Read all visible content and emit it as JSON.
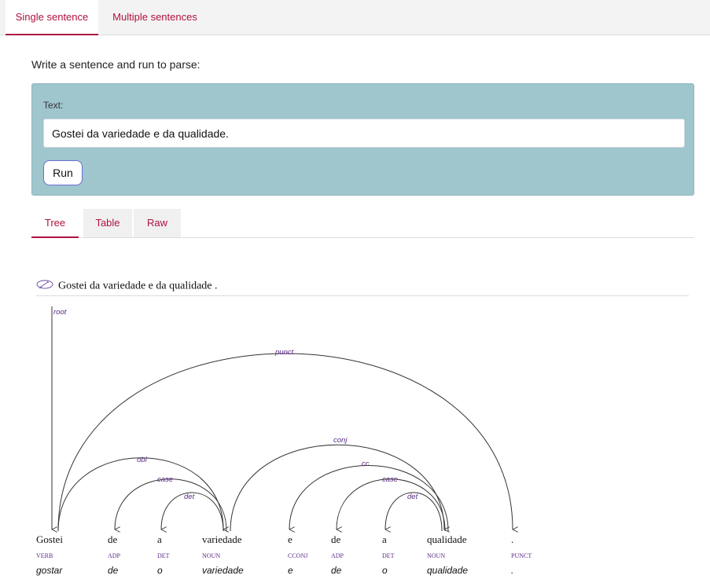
{
  "tabs": {
    "single": "Single sentence",
    "multiple": "Multiple sentences"
  },
  "prompt": "Write a sentence and run to parse:",
  "form": {
    "label": "Text:",
    "value": "Gostei da variedade e da qualidade.",
    "run": "Run"
  },
  "view_tabs": {
    "tree": "Tree",
    "table": "Table",
    "raw": "Raw"
  },
  "parse": {
    "sentence": "Gostei da variedade e da qualidade .",
    "tokens": [
      {
        "word": "Gostei",
        "pos": "VERB",
        "lemma": "gostar"
      },
      {
        "word": "de",
        "pos": "ADP",
        "lemma": "de"
      },
      {
        "word": "a",
        "pos": "DET",
        "lemma": "o"
      },
      {
        "word": "variedade",
        "pos": "NOUN",
        "lemma": "variedade"
      },
      {
        "word": "e",
        "pos": "CCONJ",
        "lemma": "e"
      },
      {
        "word": "de",
        "pos": "ADP",
        "lemma": "de"
      },
      {
        "word": "a",
        "pos": "DET",
        "lemma": "o"
      },
      {
        "word": "qualidade",
        "pos": "NOUN",
        "lemma": "qualidade"
      },
      {
        "word": ".",
        "pos": "PUNCT",
        "lemma": "."
      }
    ],
    "relations": [
      {
        "label": "root",
        "head": null,
        "dep": 0
      },
      {
        "label": "punct",
        "head": 0,
        "dep": 8
      },
      {
        "label": "obl",
        "head": 0,
        "dep": 3
      },
      {
        "label": "case",
        "head": 3,
        "dep": 1
      },
      {
        "label": "det",
        "head": 3,
        "dep": 2
      },
      {
        "label": "conj",
        "head": 3,
        "dep": 7
      },
      {
        "label": "cc",
        "head": 7,
        "dep": 4
      },
      {
        "label": "case",
        "head": 7,
        "dep": 5
      },
      {
        "label": "det",
        "head": 7,
        "dep": 6
      }
    ]
  },
  "colors": {
    "accent": "#b0123f",
    "panel": "#9fc5cd",
    "pos_label": "#5b2a86"
  }
}
